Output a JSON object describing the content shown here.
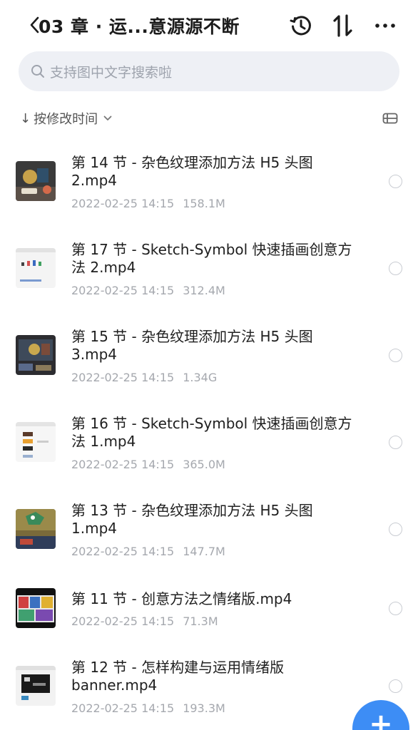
{
  "header": {
    "back_glyph": "<",
    "title": "03 章 · 运...意源源不断"
  },
  "search": {
    "placeholder": "支持图中文字搜索啦"
  },
  "sort": {
    "arrow": "↓",
    "label": "按修改时间"
  },
  "files": [
    {
      "name": "第 14 节 - 杂色纹理添加方法 H5 头图 2.mp4",
      "date": "2022-02-25 14:15",
      "size": "158.1M",
      "thumb": "illustration-dark"
    },
    {
      "name": "第 17 节 - Sketch-Symbol 快速插画创意方法 2.mp4",
      "date": "2022-02-25 14:15",
      "size": "312.4M",
      "thumb": "sketch-light"
    },
    {
      "name": "第 15 节 - 杂色纹理添加方法 H5 头图 3.mp4",
      "date": "2022-02-25 14:15",
      "size": "1.34G",
      "thumb": "illustration-dark"
    },
    {
      "name": "第 16 节 - Sketch-Symbol 快速插画创意方法 1.mp4",
      "date": "2022-02-25 14:15",
      "size": "365.0M",
      "thumb": "sketch-light"
    },
    {
      "name": "第 13 节 - 杂色纹理添加方法 H5 头图 1.mp4",
      "date": "2022-02-25 14:15",
      "size": "147.7M",
      "thumb": "illustration-dark"
    },
    {
      "name": "第 11 节 - 创意方法之情绪版.mp4",
      "date": "2022-02-25 14:15",
      "size": "71.3M",
      "thumb": "moodboard-dark"
    },
    {
      "name": "第 12 节 - 怎样构建与运用情绪版 banner.mp4",
      "date": "2022-02-25 14:15",
      "size": "193.3M",
      "thumb": "screen-light"
    }
  ],
  "fab": {
    "label": "+"
  },
  "colors": {
    "accent": "#3d8df5",
    "search_bg": "#eef0f5",
    "meta_text": "#a5a8ae"
  }
}
